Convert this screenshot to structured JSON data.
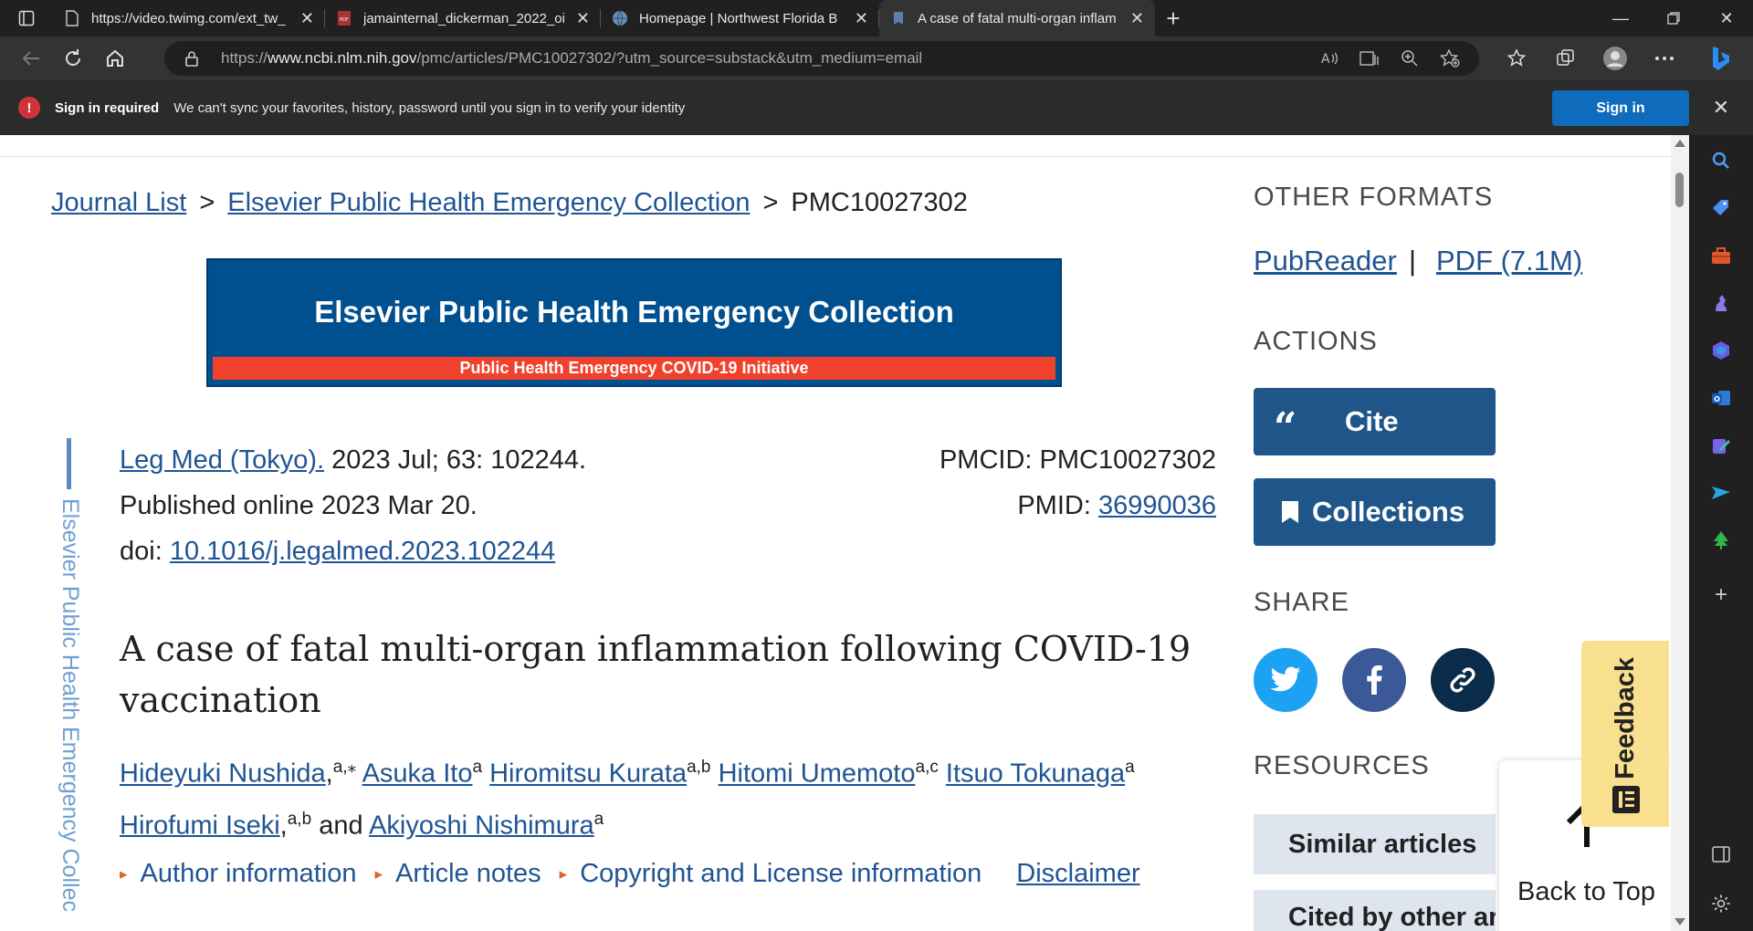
{
  "browser": {
    "tabs": [
      {
        "title": "https://video.twimg.com/ext_tw_",
        "favicon": "page-icon",
        "active": false
      },
      {
        "title": "jamainternal_dickerman_2022_oi",
        "favicon": "pdf-icon",
        "active": false
      },
      {
        "title": "Homepage | Northwest Florida B",
        "favicon": "globe-icon",
        "active": false
      },
      {
        "title": "A case of fatal multi-organ inflam",
        "favicon": "bookmark-icon",
        "active": true
      }
    ],
    "url_prefix": "https://",
    "url_host": "www.ncbi.nlm.nih.gov",
    "url_path": "/pmc/articles/PMC10027302/?utm_source=substack&utm_medium=email"
  },
  "infobar": {
    "icon": "!",
    "title": "Sign in required",
    "message": "We can't sync your favorites, history, password until you sign in to verify your identity",
    "button": "Sign in"
  },
  "breadcrumb": {
    "journal_list": "Journal List",
    "sep1": ">",
    "collection": "Elsevier Public Health Emergency Collection",
    "sep2": ">",
    "current": "PMC10027302"
  },
  "banner": {
    "title": "Elsevier Public Health Emergency Collection",
    "subtitle": "Public Health Emergency COVID-19 Initiative"
  },
  "side_collection_label": "Elsevier Public Health Emergency Collec",
  "article": {
    "journal": "Leg Med (Tokyo).",
    "citation": " 2023 Jul; 63: 102244.",
    "published": "Published online 2023 Mar 20.",
    "doi_label": "doi: ",
    "doi": "10.1016/j.legalmed.2023.102244",
    "pmcid_label": "PMCID: ",
    "pmcid": "PMC10027302",
    "pmid_label": "PMID: ",
    "pmid": "36990036",
    "title": "A case of fatal multi-organ inflammation following COVID-19 vaccination",
    "authors": [
      {
        "name": "Hideyuki Nushida",
        "sup": "a,⁎",
        "after": ","
      },
      {
        "name": "Asuka Ito",
        "sup": "a",
        "after": ""
      },
      {
        "name": "Hiromitsu Kurata",
        "sup": "a,b",
        "after": ""
      },
      {
        "name": "Hitomi Umemoto",
        "sup": "a,c",
        "after": ""
      },
      {
        "name": "Itsuo Tokunaga",
        "sup": "a",
        "after": ""
      },
      {
        "name": "Hirofumi Iseki",
        "sup": "a,b",
        "after": ","
      },
      {
        "name": "Akiyoshi Nishimura",
        "sup": "a",
        "after": ""
      }
    ],
    "and": "and",
    "tools": [
      "Author information",
      "Article notes",
      "Copyright and License information"
    ],
    "disclaimer": "Disclaimer"
  },
  "sidebar": {
    "other_formats": "OTHER FORMATS",
    "pubreader": "PubReader",
    "pipe": "|",
    "pdf": "PDF (7.1M)",
    "actions": "ACTIONS",
    "cite": "Cite",
    "collections": "Collections",
    "share": "SHARE",
    "resources": "RESOURCES",
    "similar": "Similar articles",
    "cited_by": "Cited by other articles"
  },
  "back_to_top": "Back to Top",
  "feedback": "Feedback",
  "colors": {
    "link": "#205493",
    "banner_blue": "#004f8f",
    "banner_red": "#f1412d",
    "action_blue": "#20558a",
    "twitter": "#1da1f2",
    "facebook": "#3b5998",
    "permalink": "#0b2b4a",
    "feedback": "#f8e08e",
    "signin_blue": "#0f6cbd"
  }
}
